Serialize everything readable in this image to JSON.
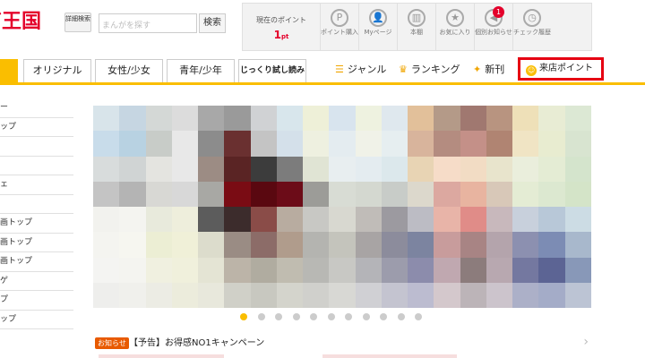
{
  "header": {
    "logo_text": "ガ王国",
    "detail_search": "詳細検索",
    "search_placeholder": "まんがを探す",
    "search_button": "検索"
  },
  "topbar": {
    "points_label": "現在のポイント",
    "points_value": "1",
    "points_unit": "pt",
    "icons": [
      {
        "label": "ポイント購入",
        "icon": "coin-p-icon",
        "glyph": "P"
      },
      {
        "label": "Myページ",
        "icon": "user-icon",
        "glyph": "👤"
      },
      {
        "label": "本棚",
        "icon": "bookshelf-icon",
        "glyph": "▥"
      },
      {
        "label": "お気に入り",
        "icon": "star-icon",
        "glyph": "★"
      },
      {
        "label": "個別お知らせ",
        "icon": "speaker-icon",
        "glyph": "◀",
        "badge": "1"
      },
      {
        "label": "チェック履歴",
        "icon": "clock-icon",
        "glyph": "◷"
      }
    ]
  },
  "tabs": [
    {
      "label": ""
    },
    {
      "label": "オリジナル"
    },
    {
      "label": "女性/少女"
    },
    {
      "label": "青年/少年"
    },
    {
      "label": "じっくり試し読み"
    }
  ],
  "gnav": [
    {
      "label": "ジャンル",
      "icon": "list-icon",
      "glyph": "☰"
    },
    {
      "label": "ランキング",
      "icon": "crown-icon",
      "glyph": "♛"
    },
    {
      "label": "新刊",
      "icon": "new-tag-icon",
      "glyph": "✦"
    }
  ],
  "visit_points": {
    "label": "来店ポイント",
    "icon": "smile-icon",
    "glyph": "☺"
  },
  "sidebar": [
    "ー",
    "ップ",
    "",
    "",
    "ェ",
    "",
    "画トップ",
    "画トップ",
    "画トップ",
    "ゲ",
    "プ",
    "ップ"
  ],
  "carousel": {
    "dot_count": 11,
    "active_index": 0,
    "palette": [
      [
        "#d8e4ea",
        "#c6d6e2",
        "#d4d8d6",
        "#dcdcdc",
        "#a8a8a8",
        "#9a9a9a",
        "#d0d2d4",
        "#d8e6ec",
        "#eef0d8",
        "#d8e4ee",
        "#eef2e0",
        "#dfe8ee",
        "#e2c09a",
        "#b49a88",
        "#a07870",
        "#b89480",
        "#eee0b8",
        "#e8ecd4",
        "#dce8d4"
      ],
      [
        "#c8dcea",
        "#b8d2e2",
        "#c8ccc8",
        "#e8e8e8",
        "#8c8c8c",
        "#6a3030",
        "#c4c4c4",
        "#d4e0ea",
        "#eef0e0",
        "#e4ecf0",
        "#f0f2e8",
        "#e6eef0",
        "#d8b49c",
        "#b48c80",
        "#c49088",
        "#b08472",
        "#f0e4c4",
        "#e8ecd0",
        "#d8e4d0"
      ],
      [
        "#d8dcdc",
        "#d0d4d4",
        "#e4e4e0",
        "#e8e8e8",
        "#9c8c84",
        "#5a2424",
        "#3c3c3c",
        "#7c7c7c",
        "#e0e4d4",
        "#e8eef0",
        "#e4ecf0",
        "#dce8ec",
        "#e8d4b4",
        "#f6dcc8",
        "#f2dcc4",
        "#e8e4cc",
        "#eaeedc",
        "#e4ecd4",
        "#d4e4cc"
      ],
      [
        "#c4c4c4",
        "#b4b4b4",
        "#d8d8d4",
        "#d8d8d8",
        "#a8a8a4",
        "#7a0c14",
        "#5a0810",
        "#6c0c18",
        "#9c9c98",
        "#d8dcd4",
        "#d4d8d0",
        "#c8ccc8",
        "#dcd8cc",
        "#dca8a0",
        "#e8b4a0",
        "#d8c8b8",
        "#e4ecd4",
        "#dce8d0",
        "#d4e4c8"
      ],
      [
        "#f2f2ee",
        "#f4f4f0",
        "#e8eadc",
        "#eeeedc",
        "#5c5c5c",
        "#3c2c2c",
        "#8a4c48",
        "#b8aca0",
        "#c8c8c4",
        "#d8d8d0",
        "#c0bcb8",
        "#9c9aa0",
        "#bcbcc4",
        "#e8b4a8",
        "#e08c88",
        "#c8b8bc",
        "#c8d0dc",
        "#b8c8d8",
        "#ccdce4"
      ],
      [
        "#f4f4f0",
        "#f6f6f0",
        "#eceed4",
        "#f0f0d8",
        "#dcdccc",
        "#9a8c84",
        "#8c6c68",
        "#b09c8c",
        "#b4b4b0",
        "#c4c4bc",
        "#a8a4a4",
        "#8c8c9c",
        "#7c84a0",
        "#c89c9c",
        "#a88484",
        "#b4a4ac",
        "#8c90b0",
        "#7c8cb4",
        "#a8b8cc"
      ],
      [
        "#f4f4f2",
        "#f4f4f0",
        "#f0f0e0",
        "#f0f0dc",
        "#e4e4d4",
        "#bcb4a8",
        "#b0aca0",
        "#c0bcb0",
        "#b8b8b4",
        "#c8c8c4",
        "#b4b4b8",
        "#9c9cac",
        "#8c8cac",
        "#c0a8b0",
        "#8c7c7c",
        "#b8a8b0",
        "#7478a0",
        "#5c6494",
        "#8898b8"
      ],
      [
        "#eeeeec",
        "#f0f0ec",
        "#ecece4",
        "#ececdc",
        "#e8e8dc",
        "#d0d0c8",
        "#c8c8c0",
        "#d4d4cc",
        "#d0d0cc",
        "#d8d8d4",
        "#d0d0d4",
        "#c4c4d0",
        "#bcbcd0",
        "#d4c8cc",
        "#bcb4b8",
        "#ccc4cc",
        "#acb0c8",
        "#a4acc8",
        "#bcc4d4"
      ]
    ]
  },
  "news": {
    "tag": "お知らせ",
    "text": "【予告】お得感NO1キャンペーン"
  },
  "colors": {
    "brand_red": "#e4002b",
    "accent_yellow": "#fabe00",
    "highlight_border": "#e60012"
  }
}
